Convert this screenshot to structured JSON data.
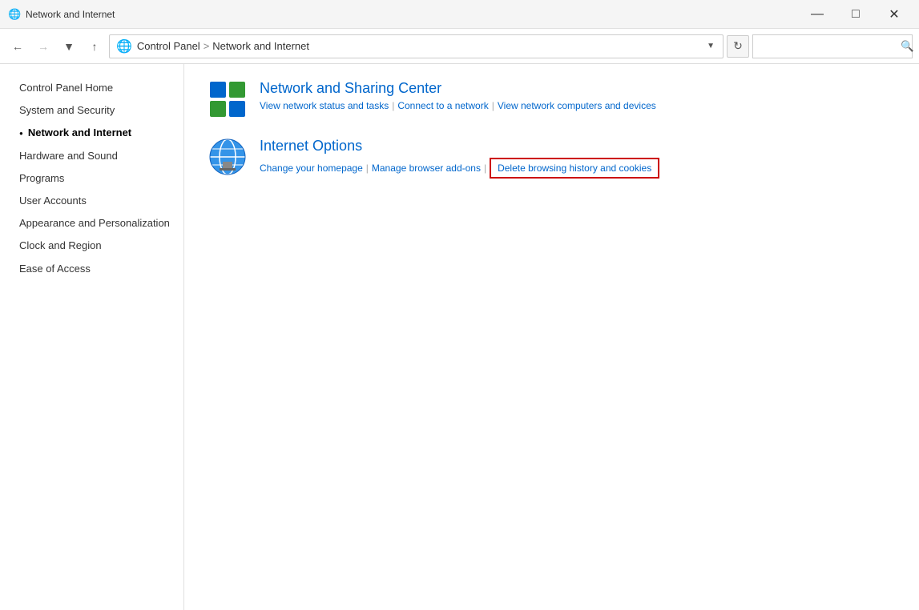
{
  "titlebar": {
    "icon": "🌐",
    "title": "Network and Internet",
    "minimize": "—",
    "maximize": "□",
    "close": "✕"
  },
  "addressbar": {
    "back_label": "←",
    "forward_label": "→",
    "dropdown_label": "▾",
    "up_label": "↑",
    "breadcrumb": {
      "separator": ">",
      "parts": [
        "Control Panel",
        "Network and Internet"
      ]
    },
    "refresh_label": "↺",
    "search_placeholder": ""
  },
  "sidebar": {
    "items": [
      {
        "id": "control-panel-home",
        "label": "Control Panel Home",
        "active": false,
        "bullet": false
      },
      {
        "id": "system-and-security",
        "label": "System and Security",
        "active": false,
        "bullet": false
      },
      {
        "id": "network-and-internet",
        "label": "Network and Internet",
        "active": true,
        "bullet": true
      },
      {
        "id": "hardware-and-sound",
        "label": "Hardware and Sound",
        "active": false,
        "bullet": false
      },
      {
        "id": "programs",
        "label": "Programs",
        "active": false,
        "bullet": false
      },
      {
        "id": "user-accounts",
        "label": "User Accounts",
        "active": false,
        "bullet": false
      },
      {
        "id": "appearance-and-personalization",
        "label": "Appearance and Personalization",
        "active": false,
        "bullet": false
      },
      {
        "id": "clock-and-region",
        "label": "Clock and Region",
        "active": false,
        "bullet": false
      },
      {
        "id": "ease-of-access",
        "label": "Ease of Access",
        "active": false,
        "bullet": false
      }
    ]
  },
  "content": {
    "sections": [
      {
        "id": "network-sharing-center",
        "title": "Network and Sharing Center",
        "links": [
          {
            "id": "view-network-status",
            "label": "View network status and tasks",
            "highlighted": false
          },
          {
            "id": "connect-to-network",
            "label": "Connect to a network",
            "highlighted": false
          },
          {
            "id": "view-network-computers",
            "label": "View network computers and devices",
            "highlighted": false
          }
        ]
      },
      {
        "id": "internet-options",
        "title": "Internet Options",
        "links": [
          {
            "id": "change-homepage",
            "label": "Change your homepage",
            "highlighted": false
          },
          {
            "id": "manage-browser-addons",
            "label": "Manage browser add-ons",
            "highlighted": false
          },
          {
            "id": "delete-browsing-history",
            "label": "Delete browsing history and cookies",
            "highlighted": true
          }
        ]
      }
    ]
  }
}
